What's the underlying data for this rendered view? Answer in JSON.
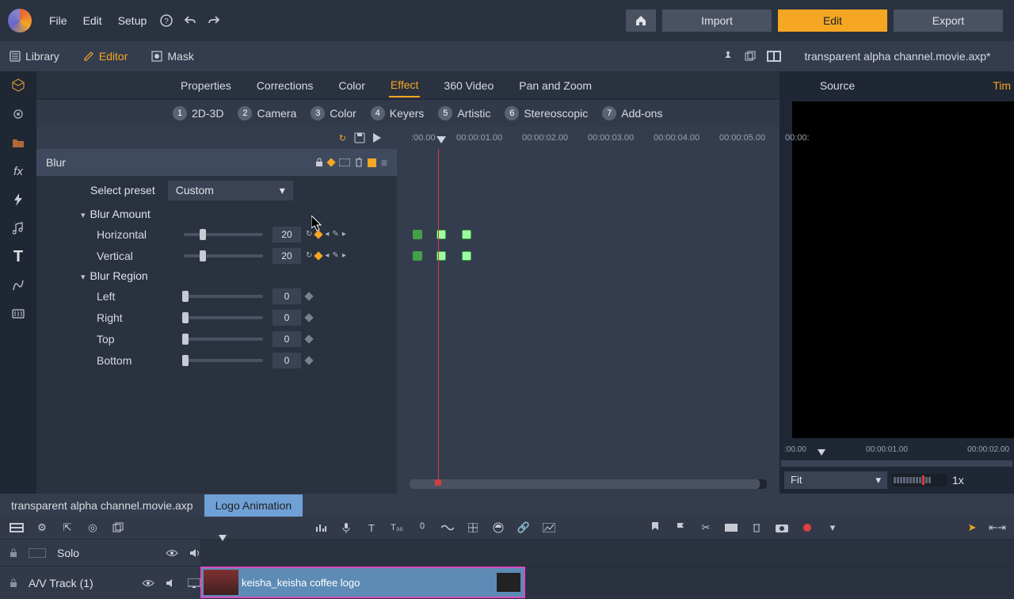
{
  "menubar": {
    "file": "File",
    "edit": "Edit",
    "setup": "Setup"
  },
  "topButtons": {
    "import": "Import",
    "edit": "Edit",
    "export": "Export"
  },
  "workspaceTabs": {
    "library": "Library",
    "editor": "Editor",
    "mask": "Mask"
  },
  "projectName": "transparent alpha channel.movie.axp*",
  "effectTabs": {
    "properties": "Properties",
    "corrections": "Corrections",
    "color": "Color",
    "effect": "Effect",
    "v360": "360 Video",
    "pan": "Pan and Zoom"
  },
  "categories": {
    "n1": "1",
    "l1": "2D-3D",
    "n2": "2",
    "l2": "Camera",
    "n3": "3",
    "l3": "Color",
    "n4": "4",
    "l4": "Keyers",
    "n5": "5",
    "l5": "Artistic",
    "n6": "6",
    "l6": "Stereoscopic",
    "n7": "7",
    "l7": "Add-ons"
  },
  "tlTimes": {
    "t0": ":00.00",
    "t1": "00:00:01.00",
    "t2": "00:00:02.00",
    "t3": "00:00:03.00",
    "t4": "00:00:04.00",
    "t5": "00:00:05.00",
    "t6": "00:00:"
  },
  "effect": {
    "name": "Blur",
    "selectPresetLabel": "Select preset",
    "presetValue": "Custom",
    "blurAmountLabel": "Blur Amount",
    "horizontalLabel": "Horizontal",
    "horizontalValue": "20",
    "verticalLabel": "Vertical",
    "verticalValue": "20",
    "blurRegionLabel": "Blur Region",
    "leftLabel": "Left",
    "leftValue": "0",
    "rightLabel": "Right",
    "rightValue": "0",
    "topLabel": "Top",
    "topValue": "0",
    "bottomLabel": "Bottom",
    "bottomValue": "0"
  },
  "sourceTabs": {
    "source": "Source",
    "time": "Tim"
  },
  "previewTimes": {
    "t0": ":00.00",
    "t1": "00:00:01.00",
    "t2": "00:00:02.00"
  },
  "fit": {
    "label": "Fit",
    "zoom": "1x"
  },
  "projectTabs": {
    "p1": "transparent alpha channel.movie.axp",
    "p2": "Logo Animation"
  },
  "tracks": {
    "solo": "Solo",
    "av1": "A/V Track (1)",
    "clipName": "keisha_keisha coffee logo"
  }
}
